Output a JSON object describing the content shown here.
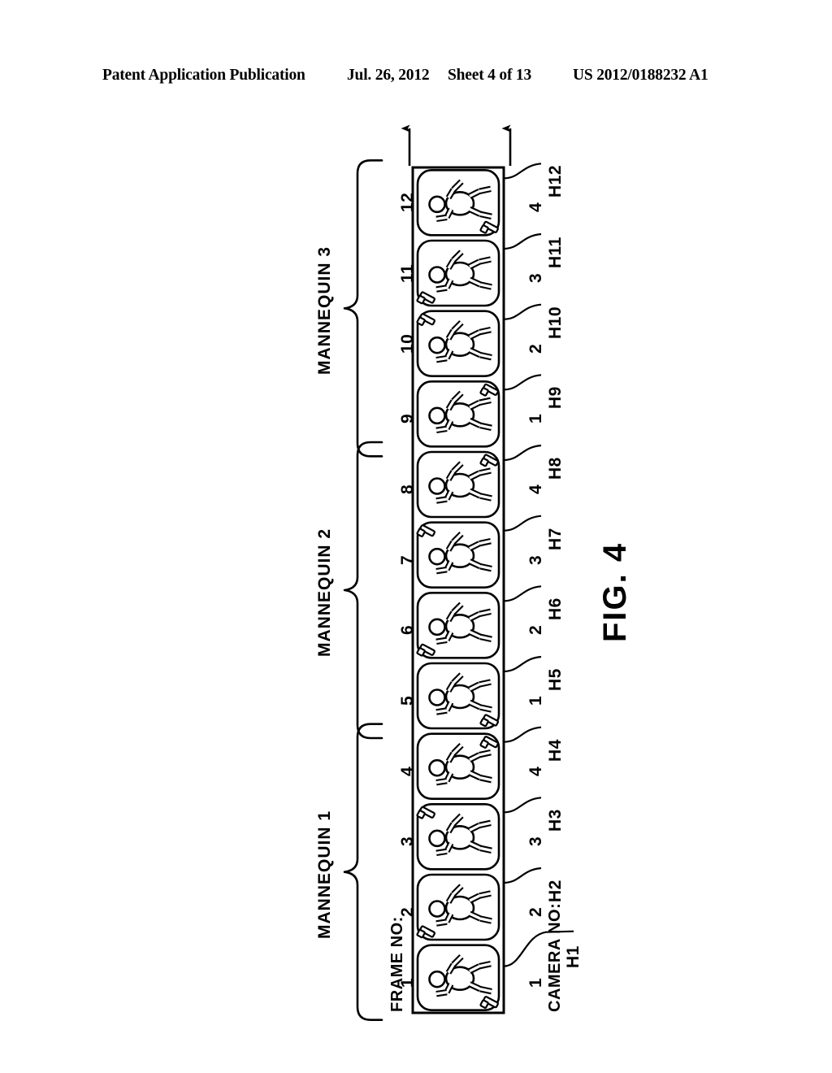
{
  "header": {
    "publication": "Patent Application Publication",
    "date": "Jul. 26, 2012",
    "sheet": "Sheet 4 of 13",
    "number": "US 2012/0188232 A1"
  },
  "figure": {
    "label": "FIG. 4",
    "frame_axis_label": "FRAME NO:",
    "camera_axis_label": "CAMERA NO:",
    "frame_numbers": [
      "1",
      "2",
      "3",
      "4",
      "5",
      "6",
      "7",
      "8",
      "9",
      "10",
      "11",
      "12"
    ],
    "camera_numbers": [
      "1",
      "2",
      "3",
      "4",
      "1",
      "2",
      "3",
      "4",
      "1",
      "2",
      "3",
      "4"
    ],
    "h_labels": [
      "H1",
      "H2",
      "H3",
      "H4",
      "H5",
      "H6",
      "H7",
      "H8",
      "H9",
      "H10",
      "H11",
      "H12"
    ],
    "groups": [
      {
        "label": "MANNEQUIN 1",
        "frames": [
          "1",
          "2",
          "3",
          "4"
        ]
      },
      {
        "label": "MANNEQUIN 2",
        "frames": [
          "5",
          "6",
          "7",
          "8"
        ]
      },
      {
        "label": "MANNEQUIN 3",
        "frames": [
          "9",
          "10",
          "11",
          "12"
        ]
      }
    ],
    "marker_corners": [
      "bottom-right",
      "bottom-left",
      "top-left",
      "top-right",
      "bottom-right",
      "bottom-left",
      "top-left",
      "top-right",
      "top-right",
      "top-left",
      "bottom-left",
      "bottom-right"
    ],
    "arrow_count": 2,
    "stroke_color": "#000000",
    "background_color": "#ffffff"
  }
}
